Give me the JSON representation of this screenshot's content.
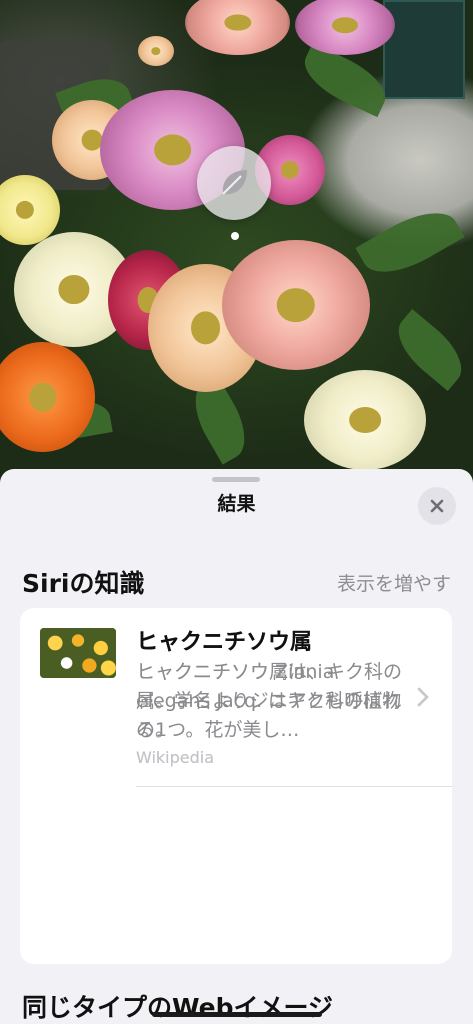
{
  "sheet": {
    "title": "結果",
    "close_icon": "close-icon"
  },
  "siri_knowledge": {
    "heading": "Siriの知識",
    "show_more": "表示を増やす",
    "results": [
      {
        "title": "ヒャクニチソウ",
        "description": "ヒャクニチソウ Zinnia elegans Jacq. はキク科の植物の1つ。花が美し…",
        "source": "Wikipedia",
        "thumbnail": "zinnia-flower-photo"
      },
      {
        "title": "ヒャクニチソウ属",
        "description": "ヒャクニチソウ属は、キク科の属。学名よりジニアとも呼ばれる。",
        "source": "Wikipedia",
        "thumbnail": "zinnia-genus-photo"
      }
    ]
  },
  "web_images": {
    "heading": "同じタイプのWebイメージ"
  },
  "photo": {
    "lookup_icon": "leaf-icon"
  }
}
